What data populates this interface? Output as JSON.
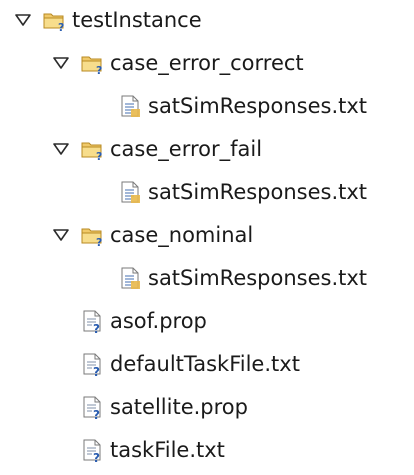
{
  "tree": {
    "root": {
      "label": "testInstance",
      "icon": "folder-question-icon",
      "expanded": true
    },
    "children": [
      {
        "label": "case_error_correct",
        "icon": "folder-question-icon",
        "expanded": true,
        "children": [
          {
            "label": "satSimResponses.txt",
            "icon": "text-file-icon"
          }
        ]
      },
      {
        "label": "case_error_fail",
        "icon": "folder-question-icon",
        "expanded": true,
        "children": [
          {
            "label": "satSimResponses.txt",
            "icon": "text-file-icon"
          }
        ]
      },
      {
        "label": "case_nominal",
        "icon": "folder-question-icon",
        "expanded": true,
        "children": [
          {
            "label": "satSimResponses.txt",
            "icon": "text-file-icon"
          }
        ]
      },
      {
        "label": "asof.prop",
        "icon": "file-question-icon"
      },
      {
        "label": "defaultTaskFile.txt",
        "icon": "file-question-icon"
      },
      {
        "label": "satellite.prop",
        "icon": "file-question-icon"
      },
      {
        "label": "taskFile.txt",
        "icon": "file-question-icon"
      }
    ]
  }
}
